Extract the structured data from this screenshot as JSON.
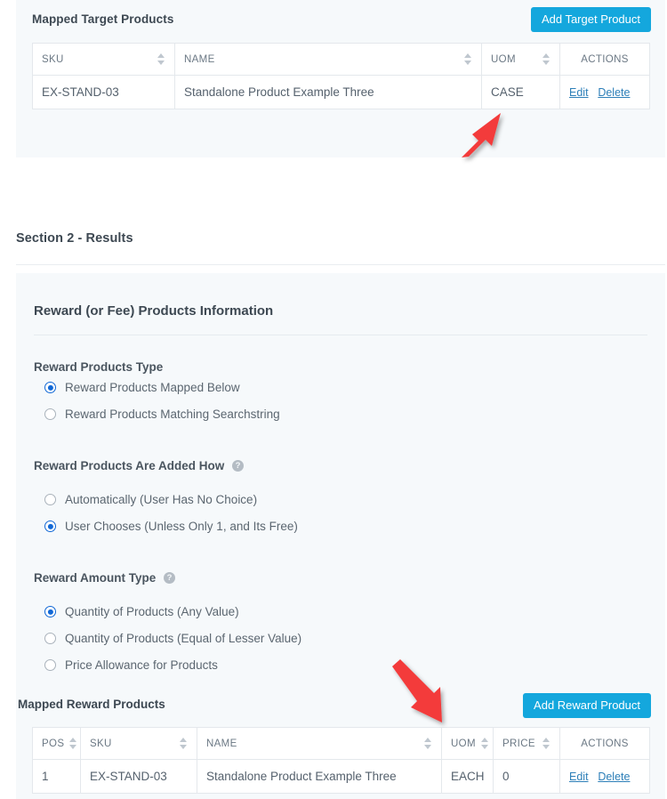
{
  "target_section": {
    "title": "Mapped Target Products",
    "add_button": "Add Target Product",
    "columns": [
      "SKU",
      "NAME",
      "UOM",
      "ACTIONS"
    ],
    "rows": [
      {
        "sku": "EX-STAND-03",
        "name": "Standalone Product Example Three",
        "uom": "CASE",
        "edit": "Edit",
        "delete": "Delete"
      }
    ]
  },
  "section2": {
    "heading": "Section 2 - Results",
    "panel_title": "Reward (or Fee) Products Information",
    "groups": [
      {
        "label": "Reward Products Type",
        "has_help": false,
        "options": [
          {
            "label": "Reward Products Mapped Below",
            "selected": true
          },
          {
            "label": "Reward Products Matching Searchstring",
            "selected": false
          }
        ]
      },
      {
        "label": "Reward Products Are Added How",
        "has_help": true,
        "options": [
          {
            "label": "Automatically (User Has No Choice)",
            "selected": false
          },
          {
            "label": "User Chooses (Unless Only 1, and Its Free)",
            "selected": true
          }
        ]
      },
      {
        "label": "Reward Amount Type",
        "has_help": true,
        "options": [
          {
            "label": "Quantity of Products (Any Value)",
            "selected": true
          },
          {
            "label": "Quantity of Products (Equal of Lesser Value)",
            "selected": false
          },
          {
            "label": "Price Allowance for Products",
            "selected": false
          }
        ]
      }
    ]
  },
  "reward_section": {
    "title": "Mapped Reward Products",
    "add_button": "Add Reward Product",
    "columns": [
      "POS",
      "SKU",
      "NAME",
      "UOM",
      "PRICE",
      "ACTIONS"
    ],
    "rows": [
      {
        "pos": "1",
        "sku": "EX-STAND-03",
        "name": "Standalone Product Example Three",
        "uom": "EACH",
        "price": "0",
        "edit": "Edit",
        "delete": "Delete"
      }
    ]
  },
  "annotations": [
    {
      "name": "arrow-to-target-uom",
      "color": "#f33a3a"
    },
    {
      "name": "arrow-to-reward-uom",
      "color": "#f33a3a"
    }
  ],
  "colors": {
    "accent_blue": "#14a7dd",
    "radio_blue": "#1168d6",
    "link_blue": "#2d7fb8",
    "panel_bg": "#f6f9fb",
    "arrow_red": "#f33a3a"
  }
}
